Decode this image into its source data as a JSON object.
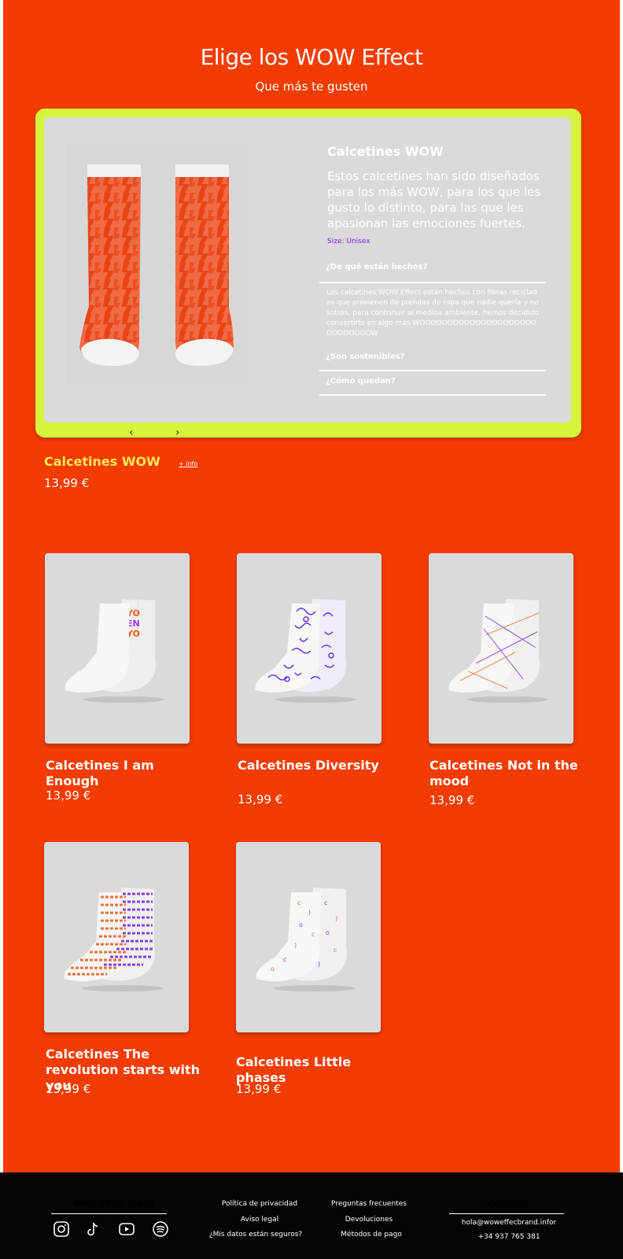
{
  "hero": {
    "title": "Elige los WOW Effect",
    "subtitle": "Que más te gusten"
  },
  "featured": {
    "image_icon": "sock-pair-pattern-icon",
    "title": "Calcetines WOW",
    "description": "Estos calcetines han sido diseñados para los más WOW, para los que les gusto lo distinto, para las que les apasionan las emociones fuertes.",
    "size": "Size: Unisex",
    "faq": [
      {
        "question": "¿De qué están hechos?",
        "answer": "Los calcetines WOW Effect están hechos con fibras recicladas que provienen de prendas de ropa que nadie quería y nosotros, para contrinuir al medioa ambiente, hemos decidido convertirlo en algo más WOOOOOOOOOOOOOOOOOOOOOOOOOOOOOW"
      },
      {
        "question": "¿Son sostenibles?"
      },
      {
        "question": "¿Cómo quedan?"
      }
    ],
    "prev_glyph": "‹",
    "next_glyph": "›",
    "name": "Calcetines WOW",
    "more_link": "+ info",
    "price": "13,99 €"
  },
  "products": [
    {
      "name": "Calcetines I am Enough",
      "price": "13,99 €",
      "icon": "sock-i-am-enough-icon"
    },
    {
      "name": "Calcetines Diversity",
      "price": "13,99 €",
      "icon": "sock-diversity-icon"
    },
    {
      "name": "Calcetines Not in the mood",
      "price": "13,99 €",
      "icon": "sock-not-in-the-mood-icon"
    },
    {
      "name": "Calcetines The revolution starts with you",
      "price": "13,99 €",
      "icon": "sock-revolution-icon"
    },
    {
      "name": "Calcetines Little phases",
      "price": "13,99 €",
      "icon": "sock-little-phases-icon"
    }
  ],
  "footer": {
    "brand": "WOW Effect Brand",
    "social": [
      "instagram-icon",
      "tiktok-icon",
      "youtube-icon",
      "spotify-icon"
    ],
    "legal": [
      "Política de privacidad",
      "Aviso legal",
      "¿Mis datos están seguros?"
    ],
    "help": [
      "Preguntas frecuentes",
      "Devoluciones",
      "Métodos de pago"
    ],
    "contact_title": "Contacto",
    "email": "hola@woweffecbrand.infor",
    "phone": "+34 937 765 381"
  },
  "colors": {
    "background": "#f53c00",
    "accent": "#d4f53c",
    "card": "#dadada",
    "footer": "#050505",
    "highlight_text": "#ffe85c",
    "size_text": "#7a1cf5"
  }
}
